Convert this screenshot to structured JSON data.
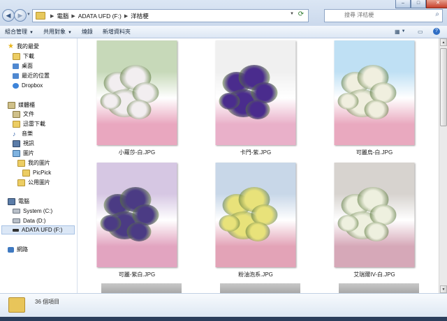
{
  "window": {
    "controls": {
      "minimize": "–",
      "maximize": "□",
      "close": "✕"
    }
  },
  "address": {
    "crumbs": [
      "電腦",
      "ADATA UFD (F:)",
      "洋桔梗"
    ],
    "search_placeholder": "搜尋 洋桔梗"
  },
  "toolbar": {
    "items": [
      "組合管理",
      "共用對象",
      "燒錄",
      "新增資料夾"
    ],
    "has_dropdown": [
      true,
      true,
      false,
      false
    ]
  },
  "nav": {
    "favorites_header": "我的最愛",
    "favorites": [
      "下載",
      "桌面",
      "最近的位置",
      "Dropbox"
    ],
    "libraries_header": "媒體櫃",
    "libraries": [
      "文件",
      "迅雷下載",
      "音樂",
      "視訊",
      "圖片",
      "我的圖片",
      "PicPick",
      "公用圖片"
    ],
    "computer_header": "電腦",
    "drives": [
      "System (C:)",
      "Data (D:)",
      "ADATA UFD (F:)"
    ],
    "selected_drive": "ADATA UFD (F:)",
    "network": "網路"
  },
  "files": [
    {
      "name": "小蘿莎-白.JPG",
      "tone": [
        "#c7d9b9",
        "#f2eef0",
        "#e9a7bf"
      ]
    },
    {
      "name": "卡門-紫.JPG",
      "tone": [
        "#f0f0f0",
        "#4a2c8d",
        "#e9b0c9"
      ]
    },
    {
      "name": "可麗烏-白.JPG",
      "tone": [
        "#bfe0f4",
        "#f0efdf",
        "#e9a9bf"
      ]
    },
    {
      "name": "可麗-紫白.JPG",
      "tone": [
        "#d6c7e3",
        "#4b3b84",
        "#e2a4c0"
      ]
    },
    {
      "name": "粉油泡系.JPG",
      "tone": [
        "#c8d7e8",
        "#e8e27a",
        "#e3a3b7"
      ]
    },
    {
      "name": "艾瑞爾IV-白.JPG",
      "tone": [
        "#d7d3cf",
        "#eef0df",
        "#d6a8b8"
      ]
    }
  ],
  "status": {
    "item_count": "36 個項目"
  },
  "colors": {
    "chrome": "#cbd9ec",
    "selection": "#dbe7f6"
  }
}
